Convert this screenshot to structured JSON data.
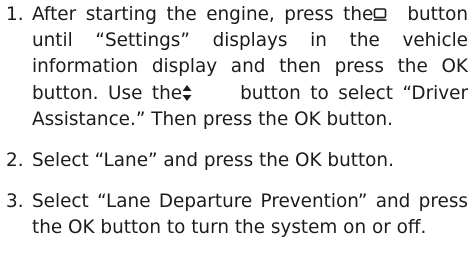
{
  "steps": [
    {
      "number": "1.",
      "segments": [
        "After starting the engine, press the",
        "button until “Settings” displays in the vehicle information display and then press the OK button. Use the",
        "button to select “Driver Assistance.” Then press the OK button."
      ],
      "icons": [
        "display-button-icon",
        "up-down-arrow-icon"
      ]
    },
    {
      "number": "2.",
      "text": "Select “Lane” and press the OK button."
    },
    {
      "number": "3.",
      "text": "Select “Lane Departure Prevention” and press the OK button to turn the system on or off."
    }
  ]
}
